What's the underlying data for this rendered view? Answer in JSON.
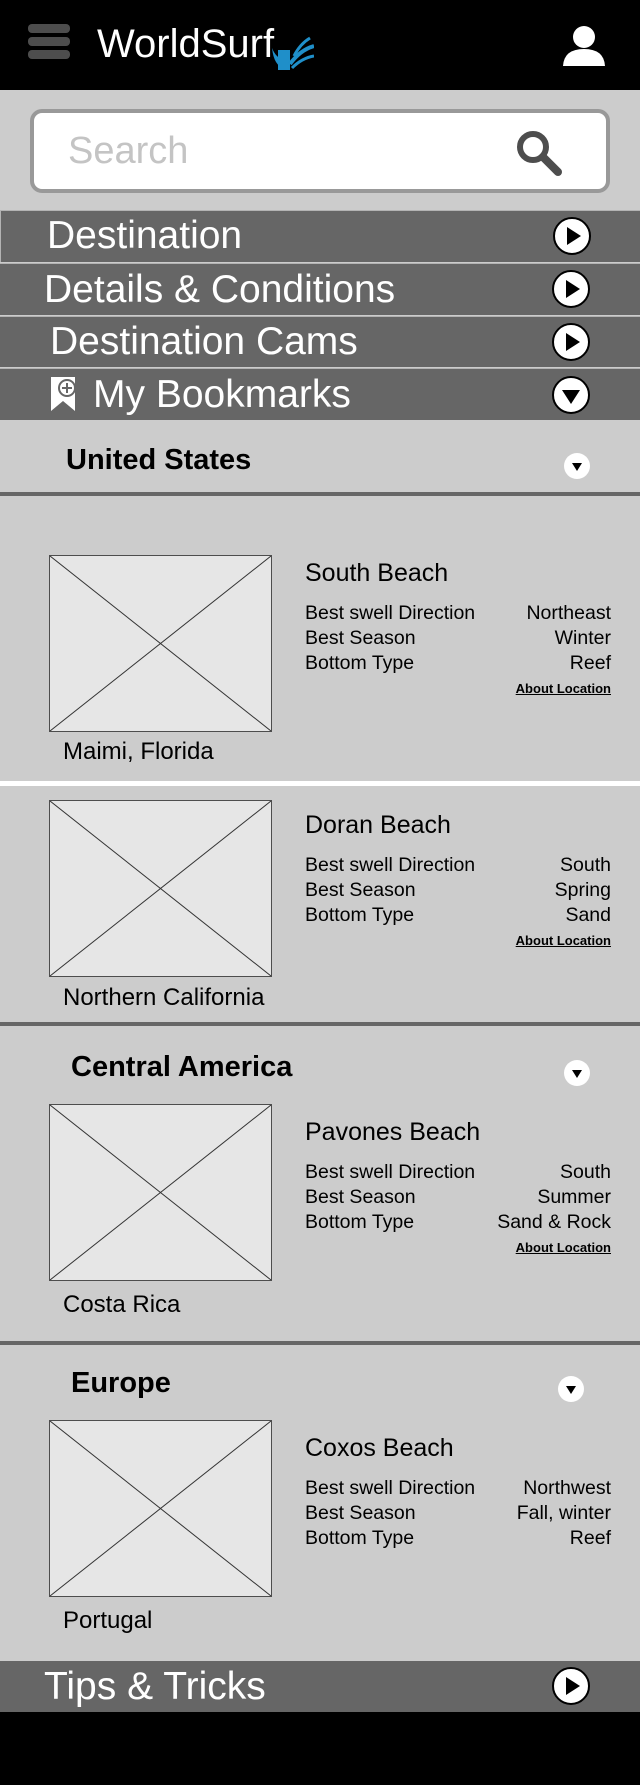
{
  "header": {
    "app_title": "WorldSurf",
    "icons": {
      "menu": "hamburger-menu-icon",
      "logo": "surf-wave-logo-icon",
      "user": "user-profile-icon"
    },
    "colors": {
      "background": "#000000",
      "logo_accent": "#1f8fc9"
    }
  },
  "search": {
    "placeholder": "Search",
    "value": ""
  },
  "nav": [
    {
      "label": "Destination",
      "icon": "play-circle-icon"
    },
    {
      "label": "Details & Conditions",
      "icon": "play-circle-icon"
    },
    {
      "label": "Destination Cams",
      "icon": "play-circle-icon"
    },
    {
      "label": "My Bookmarks",
      "icon": "chevron-down-circle-icon",
      "lead_icon": "bookmark-add-icon",
      "expanded": true
    },
    {
      "label": "Tips & Tricks",
      "icon": "play-circle-icon"
    }
  ],
  "fields": {
    "swell": "Best swell Direction",
    "season": "Best Season",
    "bottom": "Bottom Type",
    "about": "About Location"
  },
  "groups": [
    {
      "title": "United States",
      "beaches": [
        {
          "name": "South Beach",
          "place": "Maimi, Florida",
          "swell": "Northeast",
          "season": "Winter",
          "bottom": "Reef",
          "has_about": true
        },
        {
          "name": "Doran Beach",
          "place": "Northern California",
          "swell": "South",
          "season": "Spring",
          "bottom": "Sand",
          "has_about": true
        }
      ]
    },
    {
      "title": "Central America",
      "beaches": [
        {
          "name": "Pavones Beach",
          "place": "Costa Rica",
          "swell": "South",
          "season": "Summer",
          "bottom": "Sand & Rock",
          "has_about": true
        }
      ]
    },
    {
      "title": "Europe",
      "beaches": [
        {
          "name": "Coxos Beach",
          "place": "Portugal",
          "swell": "Northwest",
          "season": "Fall, winter",
          "bottom": "Reef",
          "has_about": false
        }
      ]
    }
  ],
  "colors": {
    "page_bg": "#cccccc",
    "nav_bg": "#666666",
    "footer_bg": "#000000"
  }
}
